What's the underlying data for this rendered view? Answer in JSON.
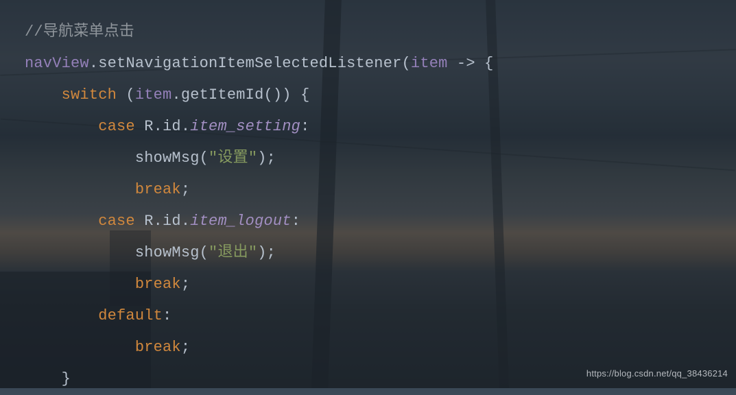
{
  "code": {
    "l1_comment": "//导航菜单点击",
    "l2_var": "navView",
    "l2_punct1": ".",
    "l2_method": "setNavigationItemSelectedListener(",
    "l2_param": "item",
    "l2_arrow": " -> {",
    "l3_switch": "switch",
    "l3_paren": " (",
    "l3_item": "item",
    "l3_getid": ".getItemId()) {",
    "l4_case": "case",
    "l4_rid": " R.id.",
    "l4_field": "item_setting",
    "l4_colon": ":",
    "l5_func": "showMsg(",
    "l5_str": "\"设置\"",
    "l5_close": ");",
    "l6_break": "break",
    "l6_semi": ";",
    "l7_case": "case",
    "l7_rid": " R.id.",
    "l7_field": "item_logout",
    "l7_colon": ":",
    "l8_func": "showMsg(",
    "l8_str": "\"退出\"",
    "l8_close": ");",
    "l9_break": "break",
    "l9_semi": ";",
    "l10_default": "default",
    "l10_colon": ":",
    "l11_break": "break",
    "l11_semi": ";",
    "l12_brace": "}"
  },
  "watermark": "https://blog.csdn.net/qq_38436214"
}
